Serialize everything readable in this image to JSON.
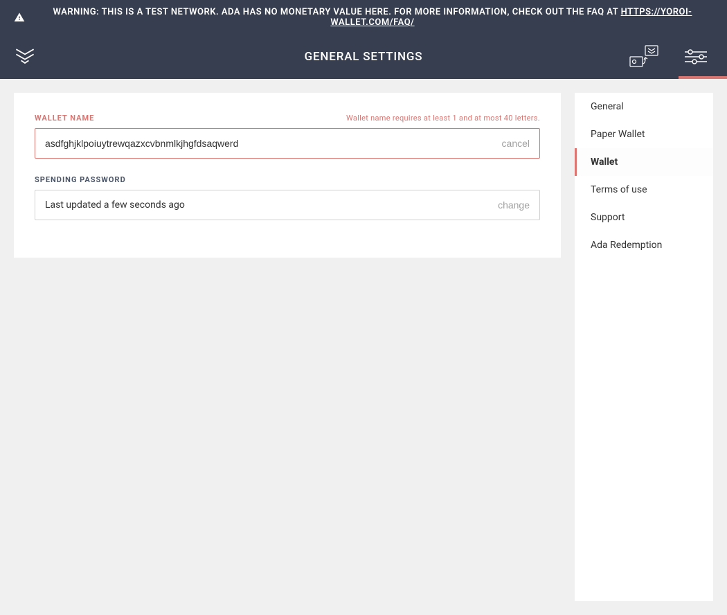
{
  "warning": {
    "text_prefix": "WARNING: THIS IS A TEST NETWORK. ADA HAS NO MONETARY VALUE HERE. FOR MORE INFORMATION, CHECK OUT THE FAQ AT ",
    "link_text": "HTTPS://YOROI-WALLET.COM/FAQ/"
  },
  "header": {
    "title": "GENERAL SETTINGS"
  },
  "main": {
    "wallet_name": {
      "label": "WALLET NAME",
      "hint": "Wallet name requires at least 1 and at most 40 letters.",
      "value": "asdfghjklpoiuytrewqazxcvbnmlkjhgfdsaqwerd",
      "action": "cancel"
    },
    "spending_password": {
      "label": "SPENDING PASSWORD",
      "status": "Last updated a few seconds ago",
      "action": "change"
    }
  },
  "sidebar": {
    "items": [
      {
        "label": "General",
        "active": false
      },
      {
        "label": "Paper Wallet",
        "active": false
      },
      {
        "label": "Wallet",
        "active": true
      },
      {
        "label": "Terms of use",
        "active": false
      },
      {
        "label": "Support",
        "active": false
      },
      {
        "label": "Ada Redemption",
        "active": false
      }
    ]
  },
  "colors": {
    "accent_error": "#da7571",
    "header_bg": "#373e50"
  }
}
